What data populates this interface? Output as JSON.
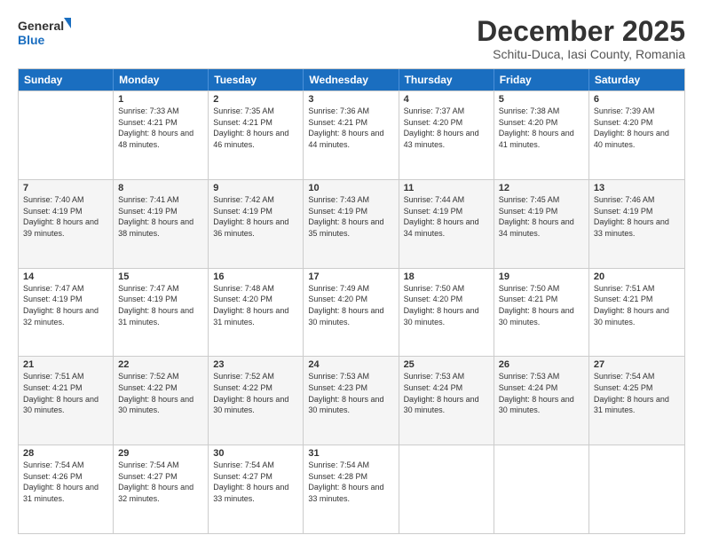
{
  "logo": {
    "general": "General",
    "blue": "Blue"
  },
  "header": {
    "month": "December 2025",
    "location": "Schitu-Duca, Iasi County, Romania"
  },
  "days": [
    "Sunday",
    "Monday",
    "Tuesday",
    "Wednesday",
    "Thursday",
    "Friday",
    "Saturday"
  ],
  "weeks": [
    [
      {
        "day": "",
        "sunrise": "",
        "sunset": "",
        "daylight": ""
      },
      {
        "day": "1",
        "sunrise": "Sunrise: 7:33 AM",
        "sunset": "Sunset: 4:21 PM",
        "daylight": "Daylight: 8 hours and 48 minutes."
      },
      {
        "day": "2",
        "sunrise": "Sunrise: 7:35 AM",
        "sunset": "Sunset: 4:21 PM",
        "daylight": "Daylight: 8 hours and 46 minutes."
      },
      {
        "day": "3",
        "sunrise": "Sunrise: 7:36 AM",
        "sunset": "Sunset: 4:21 PM",
        "daylight": "Daylight: 8 hours and 44 minutes."
      },
      {
        "day": "4",
        "sunrise": "Sunrise: 7:37 AM",
        "sunset": "Sunset: 4:20 PM",
        "daylight": "Daylight: 8 hours and 43 minutes."
      },
      {
        "day": "5",
        "sunrise": "Sunrise: 7:38 AM",
        "sunset": "Sunset: 4:20 PM",
        "daylight": "Daylight: 8 hours and 41 minutes."
      },
      {
        "day": "6",
        "sunrise": "Sunrise: 7:39 AM",
        "sunset": "Sunset: 4:20 PM",
        "daylight": "Daylight: 8 hours and 40 minutes."
      }
    ],
    [
      {
        "day": "7",
        "sunrise": "Sunrise: 7:40 AM",
        "sunset": "Sunset: 4:19 PM",
        "daylight": "Daylight: 8 hours and 39 minutes."
      },
      {
        "day": "8",
        "sunrise": "Sunrise: 7:41 AM",
        "sunset": "Sunset: 4:19 PM",
        "daylight": "Daylight: 8 hours and 38 minutes."
      },
      {
        "day": "9",
        "sunrise": "Sunrise: 7:42 AM",
        "sunset": "Sunset: 4:19 PM",
        "daylight": "Daylight: 8 hours and 36 minutes."
      },
      {
        "day": "10",
        "sunrise": "Sunrise: 7:43 AM",
        "sunset": "Sunset: 4:19 PM",
        "daylight": "Daylight: 8 hours and 35 minutes."
      },
      {
        "day": "11",
        "sunrise": "Sunrise: 7:44 AM",
        "sunset": "Sunset: 4:19 PM",
        "daylight": "Daylight: 8 hours and 34 minutes."
      },
      {
        "day": "12",
        "sunrise": "Sunrise: 7:45 AM",
        "sunset": "Sunset: 4:19 PM",
        "daylight": "Daylight: 8 hours and 34 minutes."
      },
      {
        "day": "13",
        "sunrise": "Sunrise: 7:46 AM",
        "sunset": "Sunset: 4:19 PM",
        "daylight": "Daylight: 8 hours and 33 minutes."
      }
    ],
    [
      {
        "day": "14",
        "sunrise": "Sunrise: 7:47 AM",
        "sunset": "Sunset: 4:19 PM",
        "daylight": "Daylight: 8 hours and 32 minutes."
      },
      {
        "day": "15",
        "sunrise": "Sunrise: 7:47 AM",
        "sunset": "Sunset: 4:19 PM",
        "daylight": "Daylight: 8 hours and 31 minutes."
      },
      {
        "day": "16",
        "sunrise": "Sunrise: 7:48 AM",
        "sunset": "Sunset: 4:20 PM",
        "daylight": "Daylight: 8 hours and 31 minutes."
      },
      {
        "day": "17",
        "sunrise": "Sunrise: 7:49 AM",
        "sunset": "Sunset: 4:20 PM",
        "daylight": "Daylight: 8 hours and 30 minutes."
      },
      {
        "day": "18",
        "sunrise": "Sunrise: 7:50 AM",
        "sunset": "Sunset: 4:20 PM",
        "daylight": "Daylight: 8 hours and 30 minutes."
      },
      {
        "day": "19",
        "sunrise": "Sunrise: 7:50 AM",
        "sunset": "Sunset: 4:21 PM",
        "daylight": "Daylight: 8 hours and 30 minutes."
      },
      {
        "day": "20",
        "sunrise": "Sunrise: 7:51 AM",
        "sunset": "Sunset: 4:21 PM",
        "daylight": "Daylight: 8 hours and 30 minutes."
      }
    ],
    [
      {
        "day": "21",
        "sunrise": "Sunrise: 7:51 AM",
        "sunset": "Sunset: 4:21 PM",
        "daylight": "Daylight: 8 hours and 30 minutes."
      },
      {
        "day": "22",
        "sunrise": "Sunrise: 7:52 AM",
        "sunset": "Sunset: 4:22 PM",
        "daylight": "Daylight: 8 hours and 30 minutes."
      },
      {
        "day": "23",
        "sunrise": "Sunrise: 7:52 AM",
        "sunset": "Sunset: 4:22 PM",
        "daylight": "Daylight: 8 hours and 30 minutes."
      },
      {
        "day": "24",
        "sunrise": "Sunrise: 7:53 AM",
        "sunset": "Sunset: 4:23 PM",
        "daylight": "Daylight: 8 hours and 30 minutes."
      },
      {
        "day": "25",
        "sunrise": "Sunrise: 7:53 AM",
        "sunset": "Sunset: 4:24 PM",
        "daylight": "Daylight: 8 hours and 30 minutes."
      },
      {
        "day": "26",
        "sunrise": "Sunrise: 7:53 AM",
        "sunset": "Sunset: 4:24 PM",
        "daylight": "Daylight: 8 hours and 30 minutes."
      },
      {
        "day": "27",
        "sunrise": "Sunrise: 7:54 AM",
        "sunset": "Sunset: 4:25 PM",
        "daylight": "Daylight: 8 hours and 31 minutes."
      }
    ],
    [
      {
        "day": "28",
        "sunrise": "Sunrise: 7:54 AM",
        "sunset": "Sunset: 4:26 PM",
        "daylight": "Daylight: 8 hours and 31 minutes."
      },
      {
        "day": "29",
        "sunrise": "Sunrise: 7:54 AM",
        "sunset": "Sunset: 4:27 PM",
        "daylight": "Daylight: 8 hours and 32 minutes."
      },
      {
        "day": "30",
        "sunrise": "Sunrise: 7:54 AM",
        "sunset": "Sunset: 4:27 PM",
        "daylight": "Daylight: 8 hours and 33 minutes."
      },
      {
        "day": "31",
        "sunrise": "Sunrise: 7:54 AM",
        "sunset": "Sunset: 4:28 PM",
        "daylight": "Daylight: 8 hours and 33 minutes."
      },
      {
        "day": "",
        "sunrise": "",
        "sunset": "",
        "daylight": ""
      },
      {
        "day": "",
        "sunrise": "",
        "sunset": "",
        "daylight": ""
      },
      {
        "day": "",
        "sunrise": "",
        "sunset": "",
        "daylight": ""
      }
    ]
  ]
}
